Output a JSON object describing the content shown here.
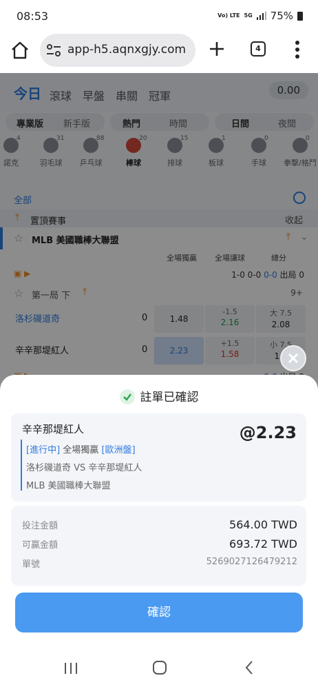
{
  "status_bar": {
    "time": "08:53",
    "volte": "Vo) LTE",
    "net": "5G",
    "battery": "75%"
  },
  "browser": {
    "url": "app-h5.aqnxgjy.com",
    "tab_count": "4"
  },
  "top_nav": {
    "today": "今日",
    "tabs": [
      "滾球",
      "早盤",
      "串關",
      "冠軍"
    ],
    "balance": "0.00"
  },
  "segments": {
    "pro": "專業版",
    "novice": "新手版",
    "hot": "熱門",
    "time": "時間",
    "day": "日間",
    "night": "夜間"
  },
  "sports": [
    {
      "name": "諾克",
      "count": "4"
    },
    {
      "name": "羽毛球",
      "count": "31"
    },
    {
      "name": "乒乓球",
      "count": "88"
    },
    {
      "name": "棒球",
      "count": "20"
    },
    {
      "name": "排球",
      "count": "15"
    },
    {
      "name": "板球",
      "count": "1"
    },
    {
      "name": "手球",
      "count": "0"
    },
    {
      "name": "拳擊/格鬥",
      "count": "0"
    }
  ],
  "filter": {
    "all": "全部"
  },
  "pinned": {
    "title": "置頂賽事",
    "collapse": "收起"
  },
  "league": {
    "name": "MLB 美國職棒大聯盟"
  },
  "columns": {
    "moneyline": "全場獨贏",
    "handicap": "全場讓球",
    "total": "總分"
  },
  "match_row1": {
    "score": "1-0 0-0",
    "score2": "0-0",
    "outs": "出局 0"
  },
  "period": {
    "label": "第一局 下",
    "more": "9+"
  },
  "match": {
    "home": {
      "name": "洛杉磯道奇",
      "score": "0",
      "moneyline": "1.48",
      "hcp_line": "-1.5",
      "hcp_odds": "2.16",
      "total_line": "大 7.5",
      "total_odds": "2.08"
    },
    "away": {
      "name": "辛辛那堤紅人",
      "score": "0",
      "moneyline": "2.23",
      "hcp_line": "+1.5",
      "hcp_odds": "1.58",
      "total_line": "小 7.5",
      "total_odds": "1.6"
    }
  },
  "match_row2": {
    "score2": "0-0",
    "outs": "出局 2"
  },
  "modal": {
    "title": "註單已確認",
    "selection": "辛辛那堤紅人",
    "odds": "@2.23",
    "status": "[進行中]",
    "market": "全場獨贏",
    "odds_type": "[歐洲盤]",
    "matchup": "洛杉磯道奇 VS 辛辛那堤紅人",
    "league": "MLB 美國職棒大聯盟",
    "stake_label": "投注金額",
    "stake": "564.00 TWD",
    "win_label": "可贏金額",
    "win": "693.72 TWD",
    "id_label": "單號",
    "id": "5269027126479212",
    "confirm": "確認"
  },
  "colors": {
    "accent": "#4a9af2",
    "brand_blue": "#2f7be0",
    "orange": "#f08a24",
    "green": "#1f9a4a",
    "red": "#d7332c"
  }
}
